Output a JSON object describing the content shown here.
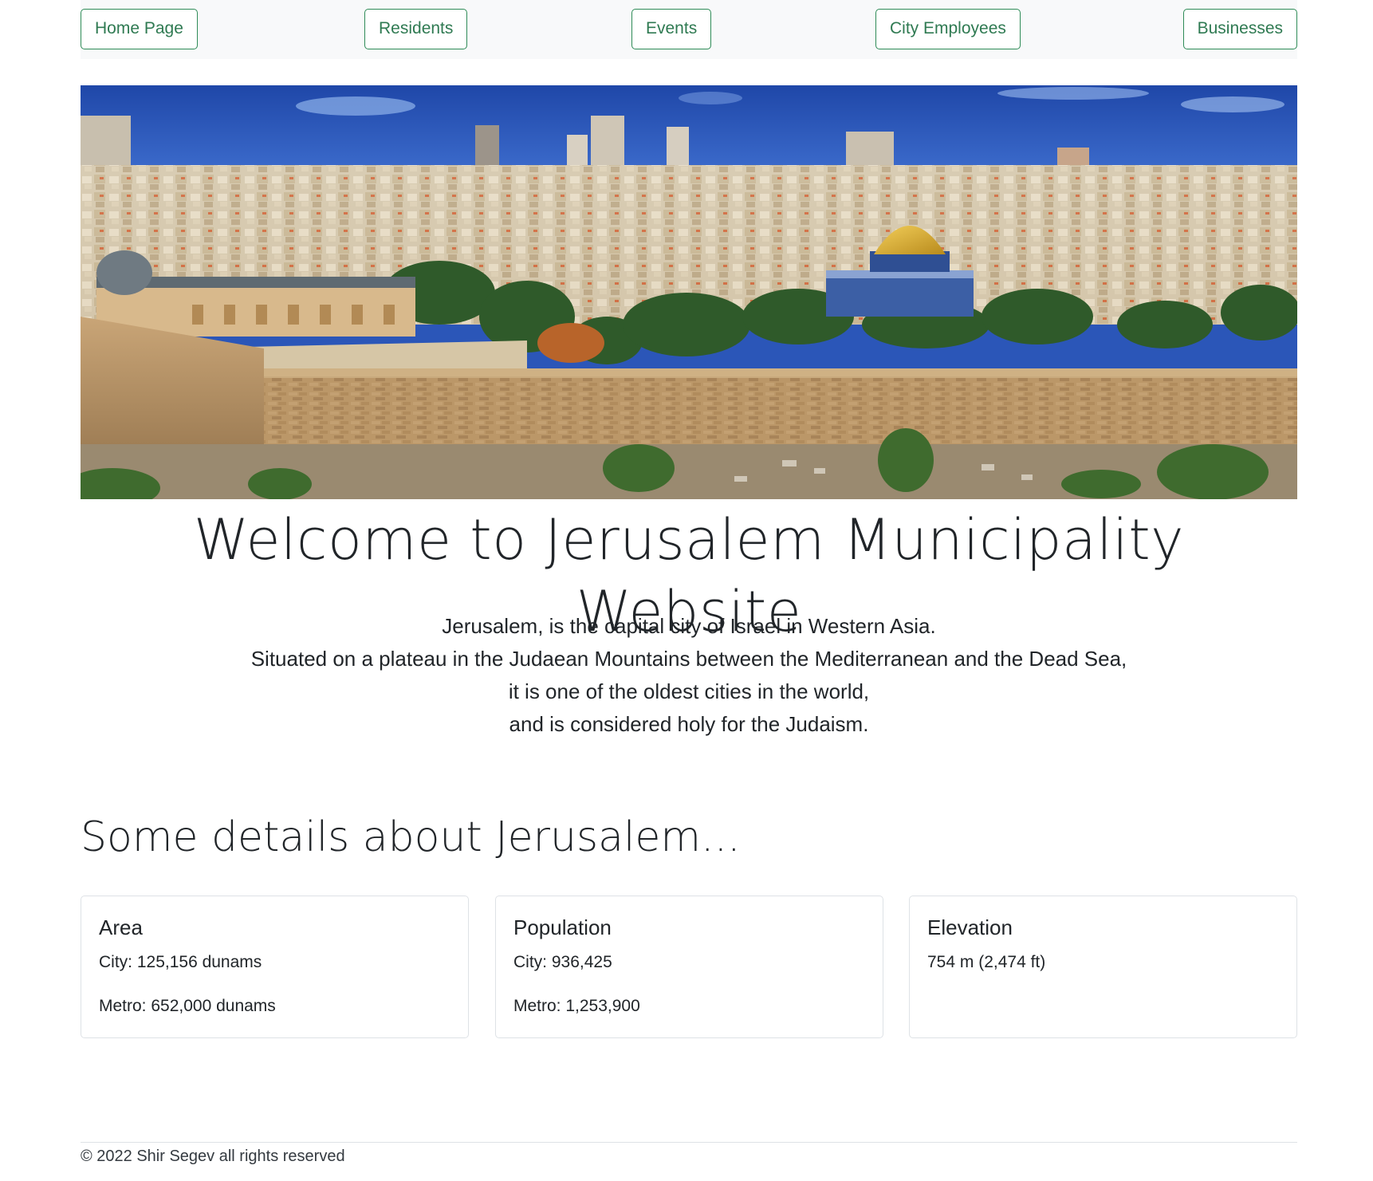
{
  "nav": {
    "items": [
      {
        "label": "Home Page"
      },
      {
        "label": "Residents"
      },
      {
        "label": "Events"
      },
      {
        "label": "City Employees"
      },
      {
        "label": "Businesses"
      }
    ]
  },
  "colors": {
    "accent": "#2e8b57",
    "nav_background": "#f8f9fa",
    "text": "#212529"
  },
  "hero": {
    "image_subject": "panoramic-jerusalem-old-city-photo"
  },
  "main": {
    "title": "Welcome to Jerusalem Municipality Website",
    "intro_lines": [
      "Jerusalem, is the capital city of Israel in Western Asia.",
      "Situated on a plateau in the Judaean Mountains between the Mediterranean and the Dead Sea,",
      "it is one of the oldest cities in the world,",
      "and is considered holy for the Judaism."
    ],
    "details_title": "Some details about Jerusalem..."
  },
  "cards": [
    {
      "title": "Area",
      "lines": [
        "City: 125,156 dunams",
        "Metro: 652,000 dunams"
      ]
    },
    {
      "title": "Population",
      "lines": [
        "City: 936,425",
        "Metro: 1,253,900"
      ]
    },
    {
      "title": "Elevation",
      "lines": [
        "754 m (2,474 ft)"
      ]
    }
  ],
  "footer": {
    "text": "© 2022 Shir Segev all rights reserved"
  }
}
